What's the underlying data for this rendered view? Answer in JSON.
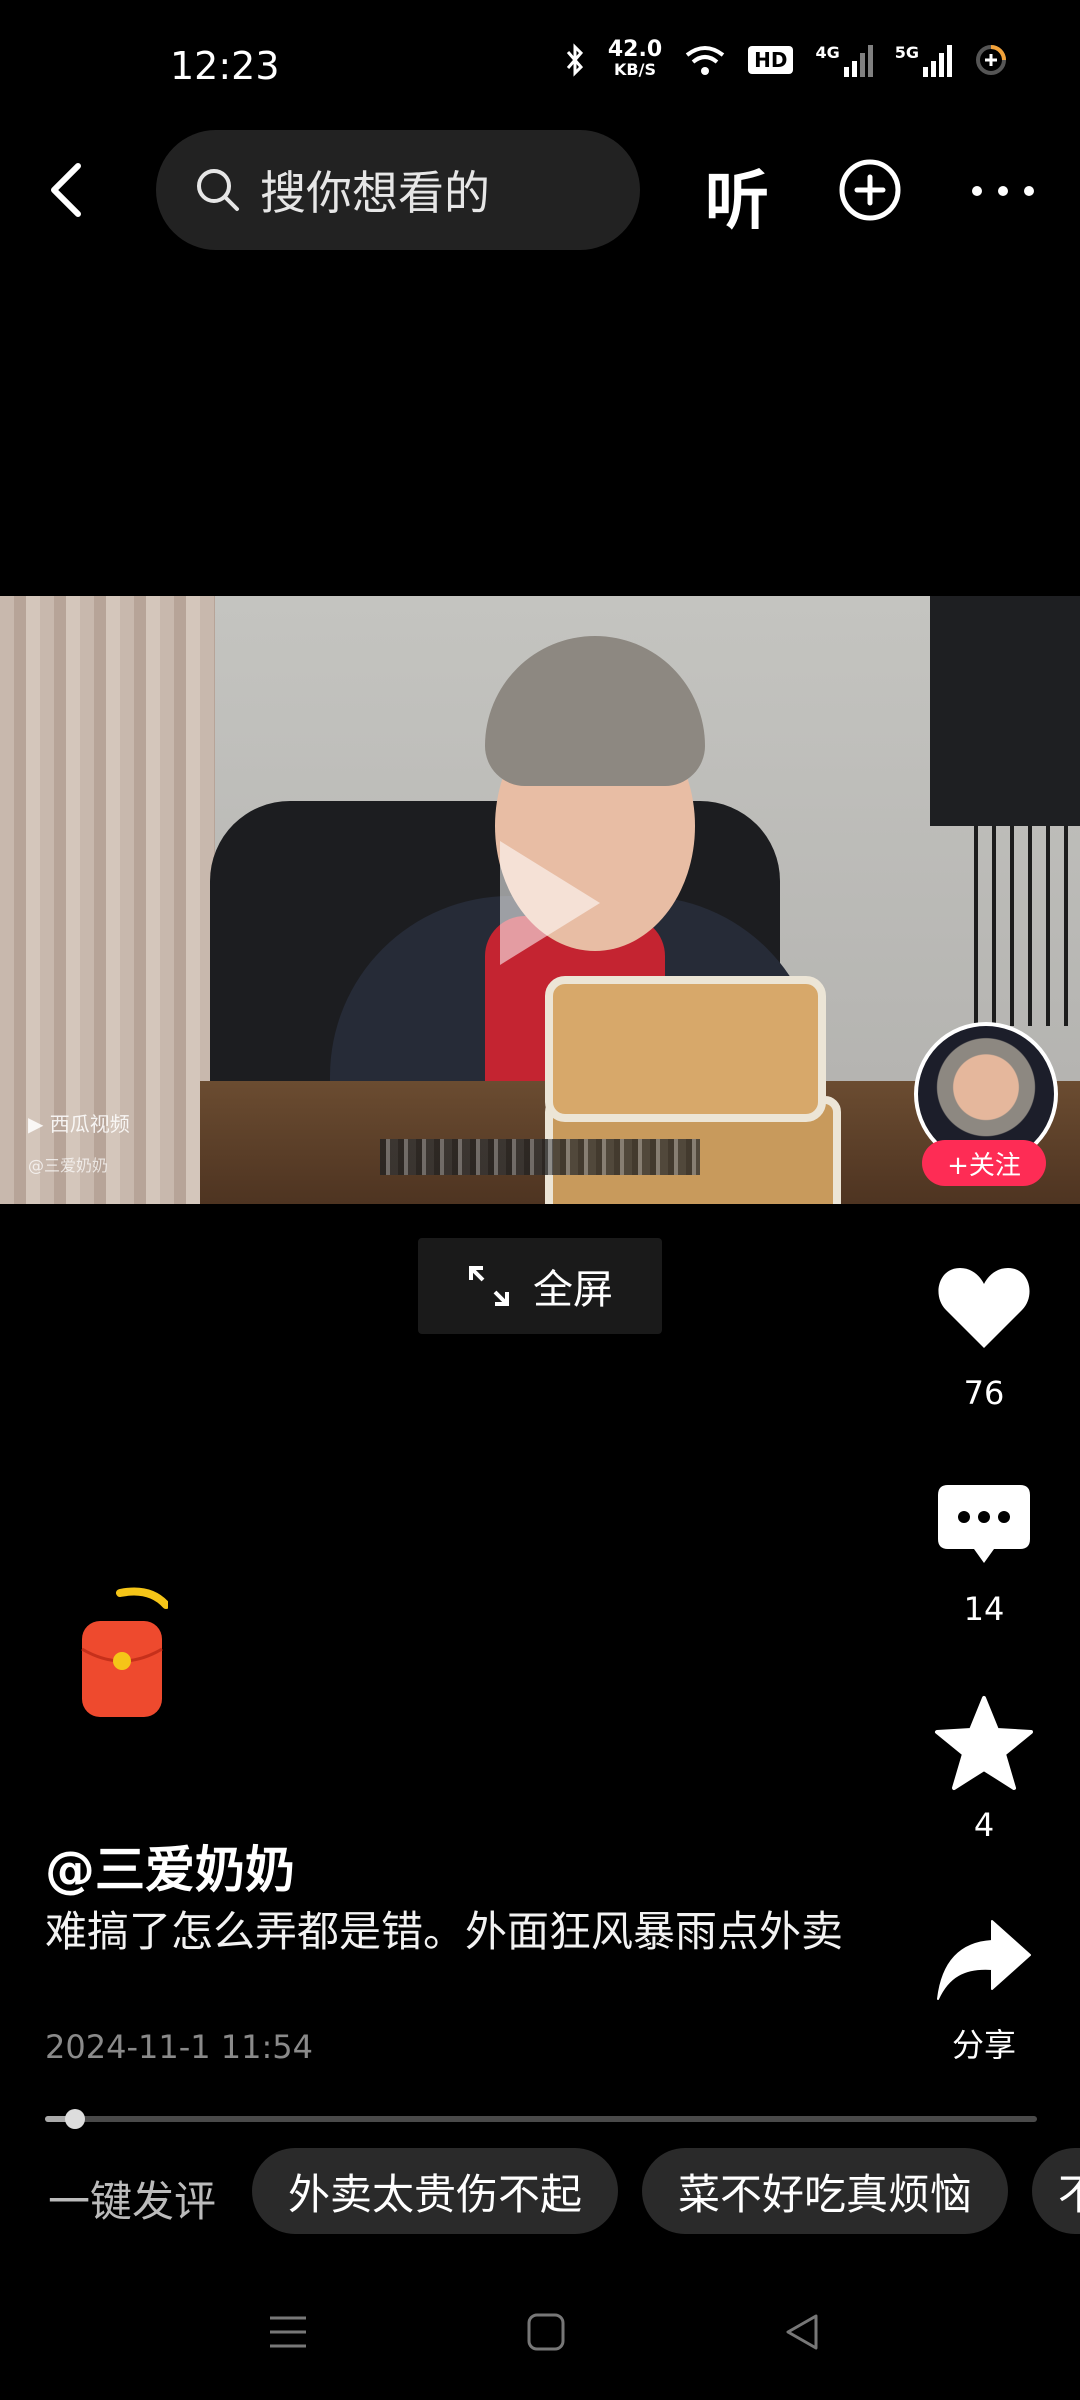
{
  "status_bar": {
    "time": "12:23",
    "speed": "42.0",
    "speed_unit": "KB/S",
    "hd_badge": "HD",
    "net1": "4G",
    "net2": "5G"
  },
  "top_bar": {
    "search_placeholder": "搜你想看的",
    "listen_label": "听"
  },
  "video": {
    "watermark": "西瓜视频",
    "watermark_sub": "@三爱奶奶",
    "follow_label": "+关注"
  },
  "fullscreen_label": "全屏",
  "actions": {
    "like_count": "76",
    "comment_count": "14",
    "favorite_count": "4",
    "share_label": "分享"
  },
  "post": {
    "author": "@三爱奶奶",
    "description": "难搞了怎么弄都是错。外面狂风暴雨点外卖",
    "date": "2024-11-1 11:54",
    "progress": 0.03
  },
  "quick_comment": {
    "label": "一键发评",
    "chips": [
      "外卖太贵伤不起",
      "菜不好吃真烦恼",
      "不"
    ]
  }
}
